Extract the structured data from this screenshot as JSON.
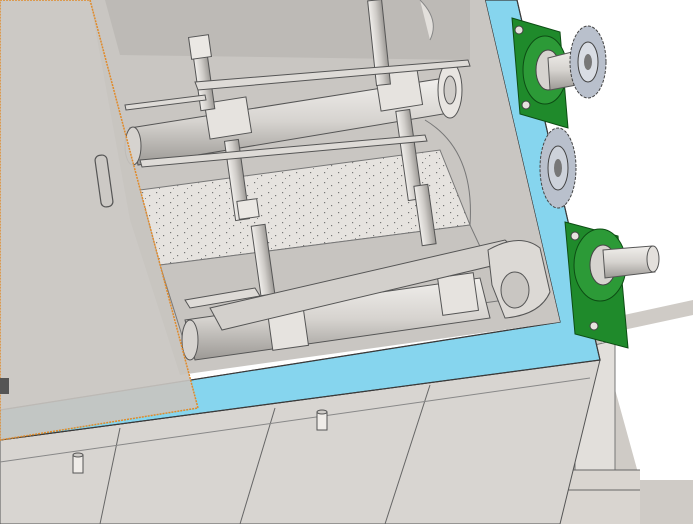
{
  "viewport": {
    "background": "#ffffff"
  },
  "colors": {
    "steel": "#d6d3cf",
    "steel_dark": "#a9a6a2",
    "steel_light": "#ece9e6",
    "frame_rim": "#86d5ee",
    "bearing_green": "#1f8a2b",
    "bearing_green_dark": "#116419",
    "edge_orange": "#e08a2a",
    "sprocket": "#b9c0cc",
    "outline": "#4a4a4a"
  },
  "scene": {
    "subject": "mixer-trough-cad-model",
    "components": [
      "trough-housing",
      "blue-top-rim",
      "cover-plate",
      "paddle-shaft-upper",
      "paddle-shaft-lower",
      "paddle-arms",
      "scraper-blades",
      "pillow-block-bearing-upper",
      "pillow-block-bearing-lower",
      "drive-sprocket-upper",
      "drive-sprocket-lower",
      "output-shaft",
      "support-frame"
    ]
  }
}
